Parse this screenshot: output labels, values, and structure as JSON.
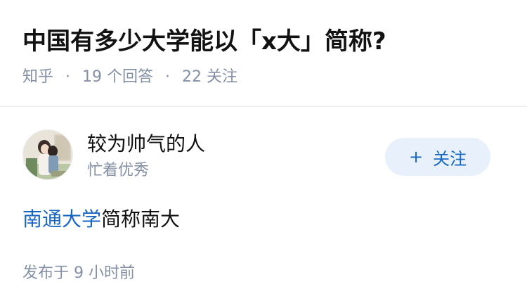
{
  "question": {
    "title": "中国有多少大学能以「x大」简称?",
    "source": "知乎",
    "separator": "·",
    "answers_count": "19 个回答",
    "followers_count": "22 关注"
  },
  "answer": {
    "author": {
      "name": "较为帅气的人",
      "headline": "忙着优秀"
    },
    "follow_button": {
      "icon": "plus-icon",
      "icon_glyph": "+",
      "label": "关注"
    },
    "content": {
      "link_text": "南通大学",
      "text": "简称南大"
    },
    "published_time": "发布于 9 小时前"
  },
  "colors": {
    "link": "#1766c2",
    "meta": "#8590a6",
    "follow_bg": "#e8f1fb"
  }
}
